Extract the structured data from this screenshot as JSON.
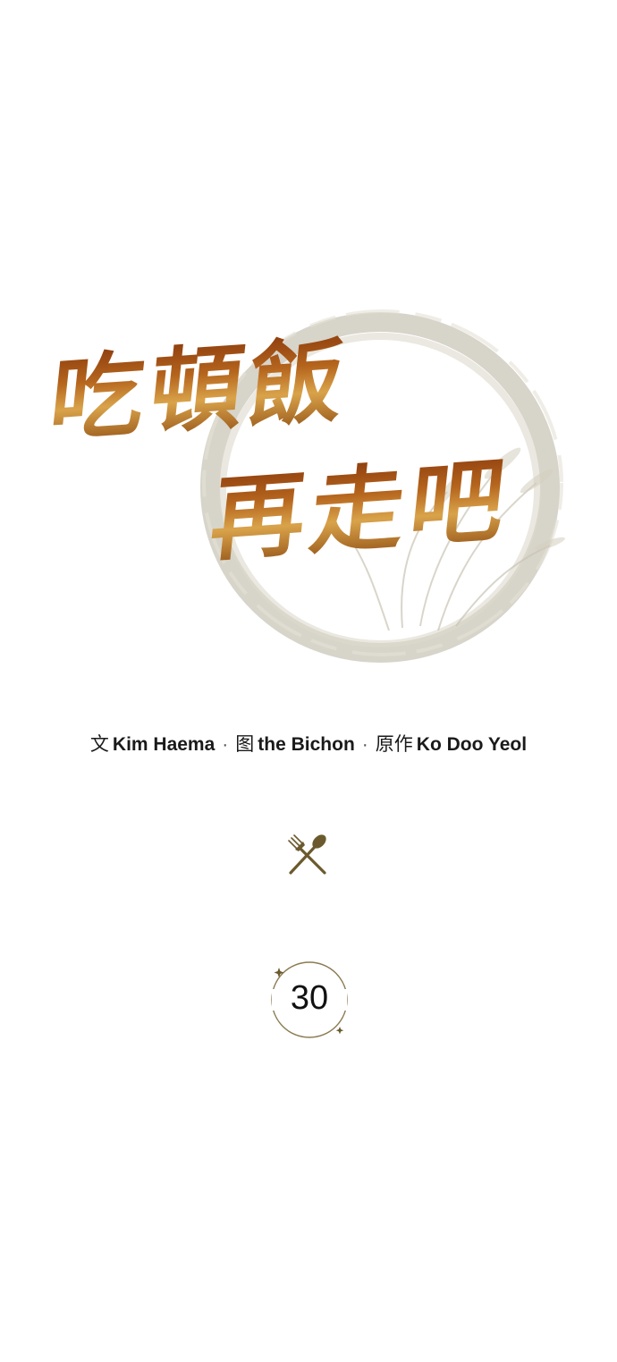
{
  "logo": {
    "title_line_1": "吃頓飯",
    "title_line_2": "再走吧"
  },
  "credits": {
    "writer_role": "文",
    "writer_name": "Kim Haema",
    "separator": "·",
    "artist_role": "图",
    "artist_name": "the Bichon",
    "original_role": "原作",
    "original_name": "Ko Doo Yeol"
  },
  "icons": {
    "utensils": "fork-spoon-crossed-icon",
    "utensils_color": "#6b5a2e",
    "ring_color": "#c9c6b8",
    "title_color": "#b5651d"
  },
  "episode": {
    "number": "30"
  }
}
